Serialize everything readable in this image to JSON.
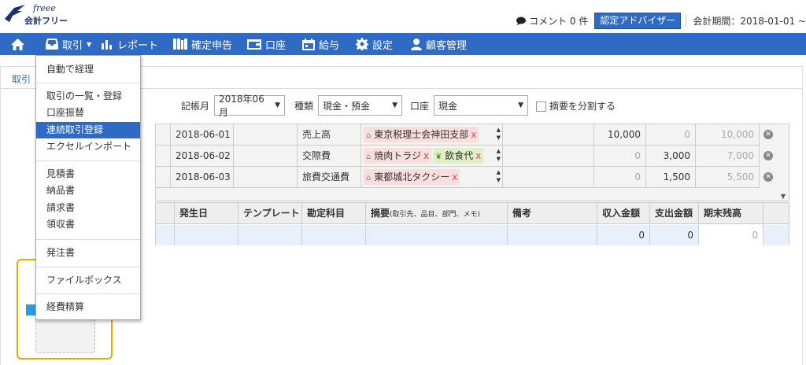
{
  "header": {
    "logo_text": "会計フリー",
    "logo_script": "freee",
    "comment_label": "コメント 0 件",
    "advisor_button": "認定アドバイザー",
    "period": "会計期間：2018-01-01 ~"
  },
  "nav": {
    "items": [
      {
        "label": "",
        "icon": "home-icon"
      },
      {
        "label": "取引",
        "icon": "inbox-icon"
      },
      {
        "label": "レポート",
        "icon": "bar-chart-icon"
      },
      {
        "label": "確定申告",
        "icon": "books-icon"
      },
      {
        "label": "口座",
        "icon": "wallet-icon"
      },
      {
        "label": "給与",
        "icon": "calendar-icon"
      },
      {
        "label": "設定",
        "icon": "gear-icon"
      },
      {
        "label": "顧客管理",
        "icon": "user-icon"
      }
    ]
  },
  "breadcrumb": "取引",
  "dropdown": {
    "items": [
      "自動で経理",
      "取引の一覧・登録",
      "口座振替",
      "連続取引登録",
      "エクセルインポート",
      "見積書",
      "納品書",
      "請求書",
      "領収書",
      "発注書",
      "ファイルボックス",
      "経費精算"
    ],
    "active": "連続取引登録"
  },
  "filters": {
    "month_label": "記帳月",
    "month_value": "2018年06月",
    "type_label": "種類",
    "type_value": "現金・預金",
    "account_label": "口座",
    "account_value": "現金",
    "split_label": "摘要を分割する"
  },
  "entries": [
    {
      "date": "2018-06-01",
      "subject": "売上高",
      "tags": [
        {
          "text": "東京税理士会神田支部",
          "icon": "house-icon",
          "color": "pink"
        }
      ],
      "income": "10,000",
      "expense": "0",
      "balance": "10,000"
    },
    {
      "date": "2018-06-02",
      "subject": "交際費",
      "tags": [
        {
          "text": "焼肉トラジ",
          "icon": "house-icon",
          "color": "pink"
        },
        {
          "text": "飲食代",
          "icon": "leaf-icon",
          "color": "green"
        }
      ],
      "income": "0",
      "expense": "3,000",
      "balance": "7,000"
    },
    {
      "date": "2018-06-03",
      "subject": "旅費交通費",
      "tags": [
        {
          "text": "東都城北タクシー",
          "icon": "house-icon",
          "color": "pink"
        }
      ],
      "income": "0",
      "expense": "1,500",
      "balance": "5,500"
    }
  ],
  "input_table": {
    "headers": {
      "date": "発生日",
      "template": "テンプレート",
      "account": "勘定科目",
      "memo": "摘要",
      "memo_hint": "(取引先、品目、部門、メモ)",
      "note": "備考",
      "income": "収入金額",
      "expense": "支出金額",
      "balance": "期末残高"
    },
    "row": {
      "income": "0",
      "expense": "0",
      "balance": "0"
    }
  }
}
